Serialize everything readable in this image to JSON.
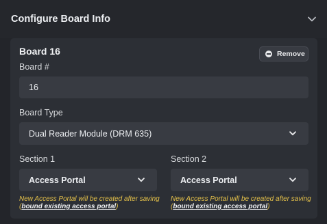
{
  "panel": {
    "title": "Configure Board Info"
  },
  "board": {
    "title": "Board 16",
    "remove_label": "Remove",
    "board_number_label": "Board #",
    "board_number_value": "16",
    "board_type_label": "Board Type",
    "board_type_value": "Dual Reader Module (DRM 635)"
  },
  "sections": [
    {
      "label": "Section 1",
      "value": "Access Portal",
      "hint_prefix": "New Access Portal will be created after saving (",
      "hint_link": "bound existing access portal",
      "hint_suffix": ")"
    },
    {
      "label": "Section 2",
      "value": "Access Portal",
      "hint_prefix": "New Access Portal will be created after saving (",
      "hint_link": "bound existing access portal",
      "hint_suffix": ")"
    }
  ],
  "colors": {
    "hint": "#e7c34a",
    "card": "#2c2f35",
    "field": "#383b42"
  }
}
